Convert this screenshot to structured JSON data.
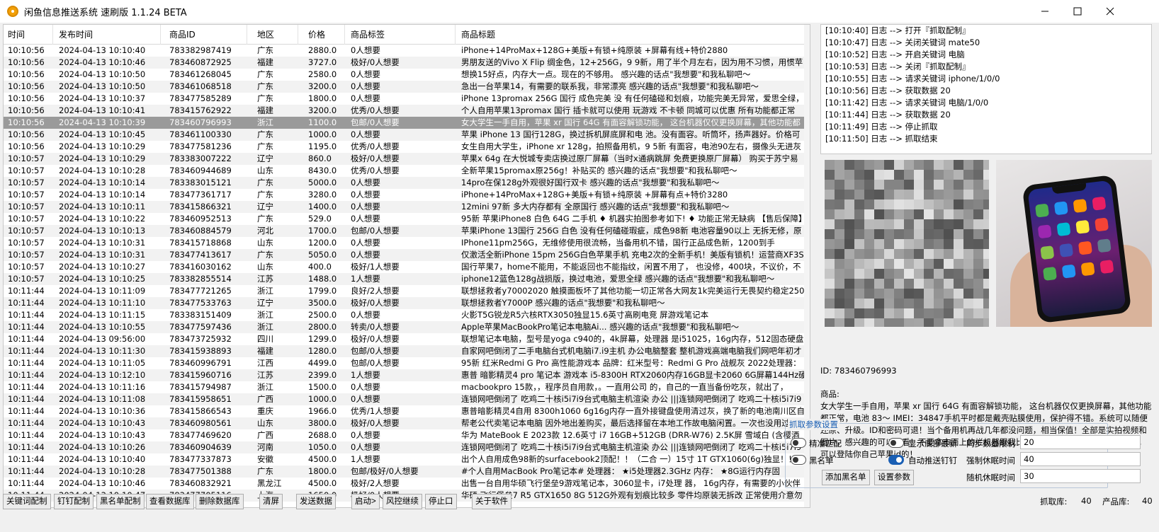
{
  "window": {
    "title": "闲鱼信息推送系统 速刷版 1.1.24 BETA"
  },
  "table": {
    "columns": [
      "时间",
      "发布时间",
      "商品ID",
      "地区",
      "价格",
      "商品标签",
      "商品标题"
    ],
    "selected_index": 6,
    "rows": [
      [
        "10:10:56",
        "2024-04-13 10:10:40",
        "783382987419",
        "广东",
        "2880.0",
        "0人想要",
        "iPhone+14ProMax+128G+美版+有锁+纯原装 +屏幕有线+特价2880"
      ],
      [
        "10:10:56",
        "2024-04-13 10:10:46",
        "783460872925",
        "福建",
        "3727.0",
        "极好/0人想要",
        "男朋友送的Vivo X Flip 绸金色，12+256G，9 9新，用了半个月左右，因为用不习惯，用惯苹"
      ],
      [
        "10:10:56",
        "2024-04-13 10:10:50",
        "783461268045",
        "广东",
        "2580.0",
        "0人想要",
        "想换15好点，内存大一点。现在的不够用。 感兴趣的话点\"我想要\"和我私聊吧～"
      ],
      [
        "10:10:56",
        "2024-04-13 10:10:50",
        "783461068518",
        "广东",
        "3200.0",
        "0人想要",
        "急出一台苹果14，有需要的联系我，非常漂亮 感兴趣的话点\"我想要\"和我私聊吧～"
      ],
      [
        "10:10:56",
        "2024-04-13 10:10:37",
        "783477585289",
        "广东",
        "1800.0",
        "0人想要",
        "iPhone 13promax 256G 国行 成色完美 没 有任何磕碰和划痕，功能完美无异常，爱思全绿，"
      ],
      [
        "10:10:56",
        "2024-04-13 10:10:41",
        "783415762922",
        "福建",
        "3200.0",
        "优秀/0人想要",
        "个人自用苹果13promax 国行  插卡就可以使用 玩游戏 不卡顿 同城可以优惠 所有功能都正常"
      ],
      [
        "10:10:56",
        "2024-04-13 10:10:39",
        "783460796993",
        "浙江",
        "1100.0",
        "包邮/0人想要",
        "女大学生一手自用，苹果 xr 国行 64G 有面容解锁功能， 这台机器仅仅更换屏幕，其他功能都"
      ],
      [
        "10:10:56",
        "2024-04-13 10:10:45",
        "783461100330",
        "广东",
        "1000.0",
        "0人想要",
        "苹果 iPhone 13 国行128G，换过拆机屏底屏和电 池。没有面容。听筒坏，扬声器好。价格可"
      ],
      [
        "10:10:56",
        "2024-04-13 10:10:29",
        "783477581236",
        "广东",
        "1195.0",
        "优秀/0人想要",
        "女生自用大学生，iPhone xr 128g，拍照备用机，9 5新 有面容，电池90左右，摄像头无进灰"
      ],
      [
        "10:10:57",
        "2024-04-13 10:10:29",
        "783383007222",
        "辽宁",
        "860.0",
        "极好/0人想要",
        "苹果x 64g 在大悦城专卖店换过原厂屏幕（当时x通病跳屏 免费更换原厂屏幕） 购买于苏宁易"
      ],
      [
        "10:10:57",
        "2024-04-13 10:10:28",
        "783460944689",
        "山东",
        "8430.0",
        "优秀/0人想要",
        "全新苹果15promax原256g！补贴买的 感兴趣的话点\"我想要\"和我私聊吧～"
      ],
      [
        "10:10:57",
        "2024-04-13 10:10:14",
        "783383015121",
        "广东",
        "5000.0",
        "0人想要",
        "14pro在保128g外观很好国行双卡 感兴趣的话点\"我想要\"和我私聊吧～"
      ],
      [
        "10:10:57",
        "2024-04-13 10:10:14",
        "783477361717",
        "广东",
        "3280.0",
        "0人想要",
        "iPhone+14ProMax+128G+美版+有锁+纯原装 +屏幕有点+特价3280"
      ],
      [
        "10:10:57",
        "2024-04-13 10:10:11",
        "783415866321",
        "辽宁",
        "1400.0",
        "0人想要",
        "12mini 97新 多大内存都有 全原国行 感兴趣的话点\"我想要\"和我私聊吧～"
      ],
      [
        "10:10:57",
        "2024-04-13 10:10:22",
        "783460952513",
        "广东",
        "529.0",
        "0人想要",
        "95新 苹果iPhone8 白色 64G 二手机 ♦ 机器实拍图参考如下! ♦ 功能正常无缺病 【售后保障】"
      ],
      [
        "10:10:57",
        "2024-04-13 10:10:13",
        "783460884579",
        "河北",
        "1700.0",
        "包邮/0人想要",
        "苹果iPhone 13国行 256G 白色 没有任何磕碰瑕疵，成色98新 电池容量90以上  无拆无修，原"
      ],
      [
        "10:10:57",
        "2024-04-13 10:10:31",
        "783415718868",
        "山东",
        "1200.0",
        "0人想要",
        "IPhone11pm256G，无维修使用很流畅，当备用机不错，国行正品成色新，1200到手"
      ],
      [
        "10:10:57",
        "2024-04-13 10:10:31",
        "783477413617",
        "广东",
        "5050.0",
        "0人想要",
        "仅激活全新iPhone 15pm 256G白色苹果手机 充电2次的全新手机！美版有锁机！运营商XF3S"
      ],
      [
        "10:10:57",
        "2024-04-13 10:10:27",
        "783416030162",
        "山东",
        "400.0",
        "极好/1人想要",
        "国行苹果7，home不能用，不能返回也不能指纹，闲置不用了， 也没修，400块，不议价，不"
      ],
      [
        "10:10:57",
        "2024-04-13 10:10:25",
        "783382855514",
        "江苏",
        "1488.0",
        "1人想要",
        "iphone12蓝色128g战损版，换过电池，爱思全绿 感兴趣的话点\"我想要\"和我私聊吧～"
      ],
      [
        "10:11:44",
        "2024-04-13 10:11:09",
        "783477721265",
        "浙江",
        "1799.0",
        "良好/2人想要",
        "联想拯救者y70002020 触摸面板坏了其他功能一切正常各大网友1k完美运行无畏契约稳定250"
      ],
      [
        "10:11:44",
        "2024-04-13 10:11:10",
        "783477533763",
        "辽宁",
        "3500.0",
        "极好/0人想要",
        "联想拯救者Y7000P 感兴趣的话点\"我想要\"和我私聊吧～"
      ],
      [
        "10:11:44",
        "2024-04-13 10:11:15",
        "783383151409",
        "浙江",
        "2500.0",
        "0人想要",
        "火影T5G锐龙R5六核RTX3050独显15.6英寸高刷电竞 屏游戏笔记本"
      ],
      [
        "10:11:44",
        "2024-04-13 10:10:55",
        "783477597436",
        "浙江",
        "2800.0",
        "转卖/0人想要",
        "Apple苹果MacBookPro笔记本电脑Ai... 感兴趣的话点\"我想要\"和我私聊吧～"
      ],
      [
        "10:11:44",
        "2024-04-13 09:56:00",
        "783473725932",
        "四川",
        "1299.0",
        "极好/0人想要",
        "联想笔记本电脑，型号是yoga c940的，4k屏幕，处理器 是i51025，16g内存，512固态硬盘"
      ],
      [
        "10:11:44",
        "2024-04-13 10:11:30",
        "783415938893",
        "福建",
        "1280.0",
        "包邮/0人想要",
        "自家网吧倒闭了二手电脑台式机电脑i7.i9主机 办公电脑整套 整机游戏高端电脑我们网吧年初才"
      ],
      [
        "10:11:44",
        "2024-04-13 10:11:05",
        "783460996791",
        "江西",
        "4499.0",
        "包邮/0人想要",
        "95新 红米Redmi G Pro 高性能游戏本 品牌：红米型号：Redmi G Pro 战舰灰 2022处理器："
      ],
      [
        "10:11:44",
        "2024-04-13 10:12:10",
        "783415960716",
        "江苏",
        "2399.0",
        "1人想要",
        "惠普 暗影精灵4 pro 笔记本 游戏本 i5-8300H RTX2060内存16GB显卡2060 6G屏幕144Hz硬"
      ],
      [
        "10:11:44",
        "2024-04-13 10:11:16",
        "783415794987",
        "浙江",
        "1500.0",
        "0人想要",
        "macbookpro 15款，，程序员自用款，。一直用公司 的，自己的一直当备份吃灰，就出了，"
      ],
      [
        "10:11:44",
        "2024-04-13 10:11:08",
        "783415958651",
        "广西",
        "1000.0",
        "0人想要",
        "连锁网吧倒闭了 吃鸡二十核i5i7i9台式电脑主机渲染 办公 |||连锁网吧倒闭了 吃鸡二十核i5i7i9"
      ],
      [
        "10:11:44",
        "2024-04-13 10:10:36",
        "783415866543",
        "重庆",
        "1966.0",
        "优秀/1人想要",
        "惠普暗影精灵4自用 8300h1060 6g16g内存一直外接键盘使用清过灰，换了新的电池南川区自"
      ],
      [
        "10:11:44",
        "2024-04-13 10:10:43",
        "783460980561",
        "山东",
        "3800.0",
        "极好/0人想要",
        "帮老公代卖笔记本电脑 因外地出差购买，最后选择留在本地工作故电脑闲置。一次也没用过，"
      ],
      [
        "10:11:44",
        "2024-04-13 10:10:43",
        "783477469620",
        "广西",
        "2688.0",
        "0人想要",
        "华为 MateBook E 2023款 12.6英寸  i7 16GB+512GB (DRR-W76) 2.5K屏 雪域白 (含樱酒"
      ],
      [
        "10:11:44",
        "2024-04-13 10:10:26",
        "783460904639",
        "河南",
        "1050.0",
        "0人想要",
        "连锁网吧倒闭了 吃鸡二十核i5i7i9台式电脑主机渲染 办公 |||连锁网吧倒闭了 吃鸡二十核i5i7i9"
      ],
      [
        "10:11:44",
        "2024-04-13 10:10:40",
        "783477337873",
        "安徽",
        "4500.0",
        "1人想要",
        "出个人自用成色98新的surfacebook2顶配！！（二合 一）15寸 1T GTX1060(6g)独显！！当"
      ],
      [
        "10:11:44",
        "2024-04-13 10:10:28",
        "783477501388",
        "广东",
        "1800.0",
        "包邮/极好/0人想要",
        "#个人自用MacBook Pro笔记本# 处理器： ★i5处理器2.3GHz         内存： ★8G运行内存固"
      ],
      [
        "10:11:44",
        "2024-04-13 10:10:46",
        "783460832921",
        "黑龙江",
        "4500.0",
        "极好/2人想要",
        "出售一台自用华硕飞行堡垒9游戏笔记本，3060显卡，i7处理 器， 16g内存，有需要的小伙伴"
      ],
      [
        "10:11:44",
        "2024-04-13 10:10:47",
        "783477705116",
        "上海",
        "1650.0",
        "极好/0人想要",
        "华硕 飞行堡垒7 R5 GTX1650 8G 512G外观有划痕比较多 零件均原装无拆改 正常使用介意勿"
      ]
    ]
  },
  "log": {
    "lines": [
      "[10:10:40] 日志 --> 打开『抓取配制』",
      "[10:10:47] 日志 --> 关闭关键词 mate50",
      "[10:10:52] 日志 --> 开启关键词 电脑",
      "[10:10:53] 日志 --> 关闭『抓取配制』",
      "[10:10:55] 日志 --> 请求关键词 iphone/1/0/0",
      "[10:10:56] 日志 --> 获取数据 20",
      "[10:11:42] 日志 --> 请求关键词 电脑/1/0/0",
      "[10:11:44] 日志 --> 获取数据 20",
      "[10:11:49] 日志 --> 停止抓取",
      "[10:11:50] 日志 --> 抓取结束"
    ]
  },
  "detail": {
    "id_text": "ID: 783460796993",
    "goods_label": "商品:",
    "goods_text": "女大学生一手自用，苹果 xr 国行 64G 有面容解锁功能， 这台机器仅仅更换屏幕，其他功能都正常，电池 83～ IMEI：34847手机平时都是戴壳贴膜使用，保护得不错。系统可以随便还原、升级。ID和密码可退！当个备用机再战几年都没问题，相当保值！全部是实拍视频和图片，感兴趣的可以看看！不要拿市面上的烂机器跟我比，我的是可以随意升级还原抹除，可以登陆你自己苹果id的！"
  },
  "settings": {
    "legend": "抓取参数设置",
    "toggles": [
      {
        "label": "精准匹配",
        "on": false
      },
      {
        "label": "显示底部最新",
        "on": false
      },
      {
        "label": "黑名单",
        "on": false
      },
      {
        "label": "自动推送钉钉",
        "on": true
      }
    ],
    "fields": [
      {
        "label": "同步数量限制",
        "value": "20"
      },
      {
        "label": "强制休眠时间",
        "value": "40"
      },
      {
        "label": "随机休眠时间",
        "value": "30"
      }
    ],
    "add_blacklist": "添加黑名单",
    "set_params": "设置参数"
  },
  "toolbar": {
    "buttons": [
      "关键词配制",
      "钉钉配制",
      "黑名单配制",
      "查看数据库",
      "删除数据库",
      "清屏",
      "发送数据",
      "启动>",
      "风控继续",
      "停止口",
      "关于软件"
    ]
  },
  "status": {
    "grab_label": "抓取库:",
    "grab_value": "40",
    "product_label": "产品库:",
    "product_value": "40"
  },
  "colors": {
    "accent": "#1a5fb4",
    "selected_row": "#9a9a9a",
    "app_icon": "#f2a007"
  }
}
